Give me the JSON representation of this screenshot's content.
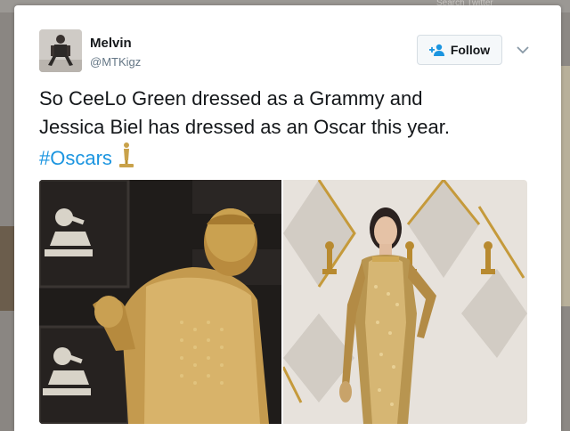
{
  "background": {
    "search_hint": "Search Twitter"
  },
  "tweet": {
    "author_name": "Melvin",
    "author_handle": "@MTKigz",
    "follow_label": "Follow",
    "text_line1": "So CeeLo Green dressed as a Grammy and",
    "text_line2": "Jessica Biel has dressed as an Oscar this year.",
    "hashtag": "#Oscars",
    "emoji": "trophy-statue"
  },
  "icons": {
    "follow": "add-user-icon",
    "caret": "chevron-down-icon"
  },
  "colors": {
    "link": "#1b95e0",
    "text": "#14171a",
    "secondary": "#657786",
    "gold": "#c9a24a"
  }
}
